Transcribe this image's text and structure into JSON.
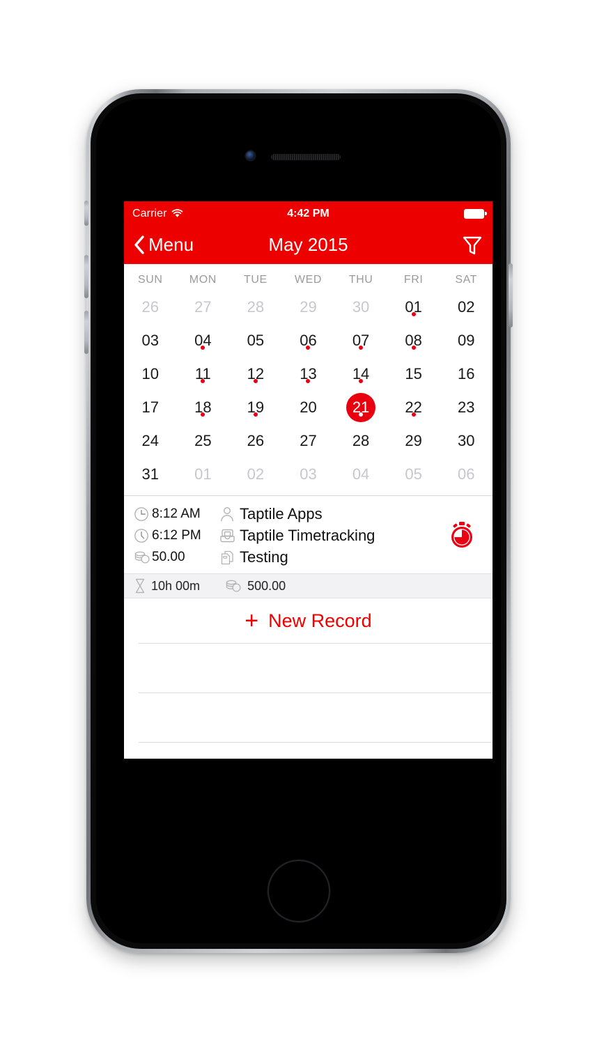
{
  "status_bar": {
    "carrier": "Carrier",
    "wifi_icon": "wifi-icon",
    "time": "4:42 PM",
    "battery_icon": "battery-full-icon"
  },
  "nav_bar": {
    "back_icon": "chevron-left-icon",
    "back_label": "Menu",
    "title": "May 2015",
    "filter_icon": "filter-funnel-icon"
  },
  "calendar": {
    "weekdays": [
      "SUN",
      "MON",
      "TUE",
      "WED",
      "THU",
      "FRI",
      "SAT"
    ],
    "weeks": [
      [
        {
          "label": "26",
          "muted": true,
          "dot": false,
          "selected": false
        },
        {
          "label": "27",
          "muted": true,
          "dot": false,
          "selected": false
        },
        {
          "label": "28",
          "muted": true,
          "dot": false,
          "selected": false
        },
        {
          "label": "29",
          "muted": true,
          "dot": false,
          "selected": false
        },
        {
          "label": "30",
          "muted": true,
          "dot": false,
          "selected": false
        },
        {
          "label": "01",
          "muted": false,
          "dot": true,
          "selected": false
        },
        {
          "label": "02",
          "muted": false,
          "dot": false,
          "selected": false
        }
      ],
      [
        {
          "label": "03",
          "muted": false,
          "dot": false,
          "selected": false
        },
        {
          "label": "04",
          "muted": false,
          "dot": true,
          "selected": false
        },
        {
          "label": "05",
          "muted": false,
          "dot": false,
          "selected": false
        },
        {
          "label": "06",
          "muted": false,
          "dot": true,
          "selected": false
        },
        {
          "label": "07",
          "muted": false,
          "dot": true,
          "selected": false
        },
        {
          "label": "08",
          "muted": false,
          "dot": true,
          "selected": false
        },
        {
          "label": "09",
          "muted": false,
          "dot": false,
          "selected": false
        }
      ],
      [
        {
          "label": "10",
          "muted": false,
          "dot": false,
          "selected": false
        },
        {
          "label": "11",
          "muted": false,
          "dot": true,
          "selected": false
        },
        {
          "label": "12",
          "muted": false,
          "dot": true,
          "selected": false
        },
        {
          "label": "13",
          "muted": false,
          "dot": true,
          "selected": false
        },
        {
          "label": "14",
          "muted": false,
          "dot": true,
          "selected": false
        },
        {
          "label": "15",
          "muted": false,
          "dot": false,
          "selected": false
        },
        {
          "label": "16",
          "muted": false,
          "dot": false,
          "selected": false
        }
      ],
      [
        {
          "label": "17",
          "muted": false,
          "dot": false,
          "selected": false
        },
        {
          "label": "18",
          "muted": false,
          "dot": true,
          "selected": false
        },
        {
          "label": "19",
          "muted": false,
          "dot": true,
          "selected": false
        },
        {
          "label": "20",
          "muted": false,
          "dot": false,
          "selected": false
        },
        {
          "label": "21",
          "muted": false,
          "dot": true,
          "selected": true
        },
        {
          "label": "22",
          "muted": false,
          "dot": true,
          "selected": false
        },
        {
          "label": "23",
          "muted": false,
          "dot": false,
          "selected": false
        }
      ],
      [
        {
          "label": "24",
          "muted": false,
          "dot": false,
          "selected": false
        },
        {
          "label": "25",
          "muted": false,
          "dot": false,
          "selected": false
        },
        {
          "label": "26",
          "muted": false,
          "dot": false,
          "selected": false
        },
        {
          "label": "27",
          "muted": false,
          "dot": false,
          "selected": false
        },
        {
          "label": "28",
          "muted": false,
          "dot": false,
          "selected": false
        },
        {
          "label": "29",
          "muted": false,
          "dot": false,
          "selected": false
        },
        {
          "label": "30",
          "muted": false,
          "dot": false,
          "selected": false
        }
      ],
      [
        {
          "label": "31",
          "muted": false,
          "dot": false,
          "selected": false
        },
        {
          "label": "01",
          "muted": true,
          "dot": false,
          "selected": false
        },
        {
          "label": "02",
          "muted": true,
          "dot": false,
          "selected": false
        },
        {
          "label": "03",
          "muted": true,
          "dot": false,
          "selected": false
        },
        {
          "label": "04",
          "muted": true,
          "dot": false,
          "selected": false
        },
        {
          "label": "05",
          "muted": true,
          "dot": false,
          "selected": false
        },
        {
          "label": "06",
          "muted": true,
          "dot": false,
          "selected": false
        }
      ]
    ]
  },
  "record": {
    "start_time_icon": "clock-icon",
    "start_time": "8:12 AM",
    "client_icon": "person-icon",
    "client": "Taptile Apps",
    "end_time_icon": "clock-icon",
    "end_time": "6:12 PM",
    "project_icon": "tray-icon",
    "project": "Taptile Timetracking",
    "rate_icon": "coins-icon",
    "rate": "50.00",
    "task_icon": "documents-icon",
    "task": "Testing",
    "timer_icon": "stopwatch-icon"
  },
  "summary": {
    "duration_icon": "hourglass-icon",
    "duration": "10h 00m",
    "amount_icon": "coins-icon",
    "amount": "500.00"
  },
  "new_record": {
    "plus_icon": "plus-icon",
    "label": "New Record"
  },
  "empty_rows_count": 5,
  "colors": {
    "brand_red": "#ec0000",
    "accent_red": "#ee0000",
    "selected_day": "#e8000f",
    "muted_text": "#c7c7cc",
    "weekday_text": "#9a9a9e",
    "summary_bg": "#f2f2f4",
    "separator": "#d9d9db"
  }
}
